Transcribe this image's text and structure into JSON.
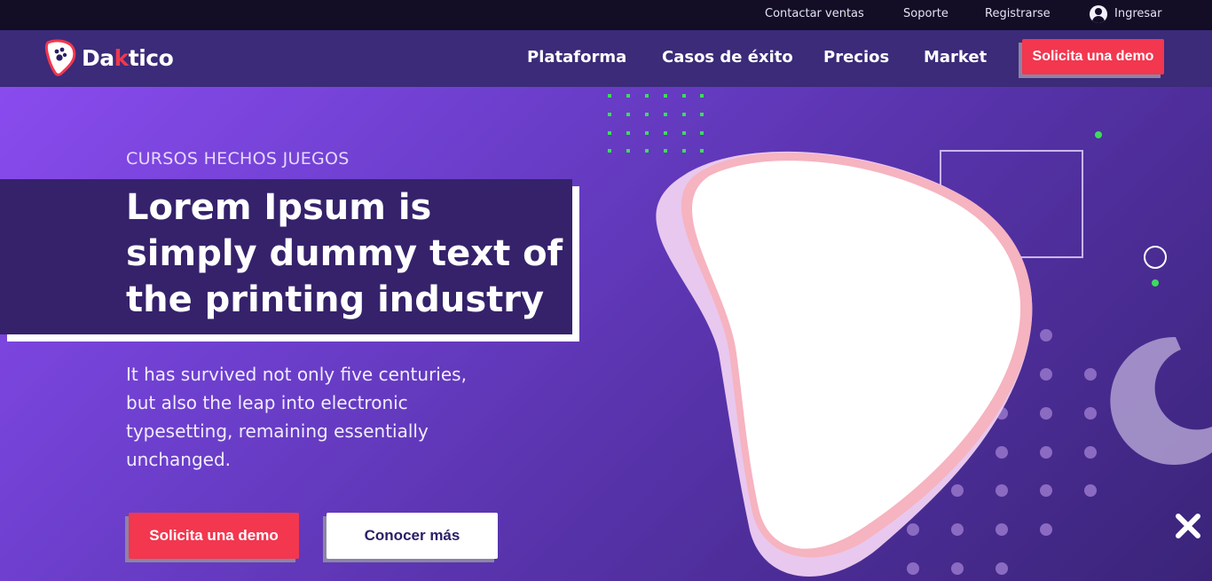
{
  "topbar": {
    "contact_sales": "Contactar ventas",
    "support": "Soporte",
    "register": "Registrarse",
    "login": "Ingresar",
    "login_icon": "user-circle-icon"
  },
  "brand": {
    "name_before": "Da",
    "name_k": "k",
    "name_after": "tico",
    "logo_icon": "paw-tooth-logo-icon"
  },
  "nav": {
    "items": [
      "Plataforma",
      "Casos de éxito",
      "Precios",
      "Market"
    ],
    "cta": "Solicita una demo"
  },
  "hero": {
    "eyebrow": "CURSOS HECHOS JUEGOS",
    "title": "Lorem Ipsum is simply dummy text of the printing industry",
    "lead": "It has survived not only five centuries, but also the leap into electronic typesetting, remaining essentially unchanged.",
    "primary_cta": "Solicita una demo",
    "secondary_cta": "Conocer más"
  },
  "close_icon": "close-x-icon",
  "colors": {
    "accent_red": "#f2374f",
    "nav_purple": "#3b2b78",
    "topbar_dark": "#130d26",
    "dot_green": "#3ddc5c",
    "blob_pink": "#f6b3c0",
    "blob_lilac": "#e8c8ee"
  }
}
